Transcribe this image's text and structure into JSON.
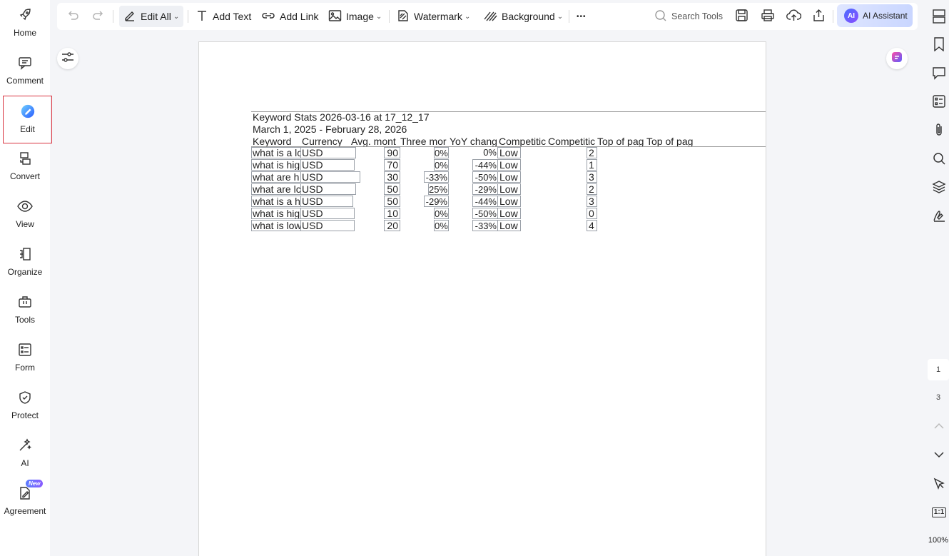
{
  "sidebar": {
    "items": [
      {
        "label": "Home",
        "icon": "rocket-icon"
      },
      {
        "label": "Comment",
        "icon": "comment-icon"
      },
      {
        "label": "Edit",
        "icon": "edit-logo-icon"
      },
      {
        "label": "Convert",
        "icon": "convert-icon"
      },
      {
        "label": "View",
        "icon": "eye-icon"
      },
      {
        "label": "Organize",
        "icon": "organize-icon"
      },
      {
        "label": "Tools",
        "icon": "toolbox-icon"
      },
      {
        "label": "Form",
        "icon": "form-icon"
      },
      {
        "label": "Protect",
        "icon": "shield-icon"
      },
      {
        "label": "AI",
        "icon": "magic-wand-icon"
      },
      {
        "label": "Agreement",
        "icon": "agreement-icon",
        "badge": "New"
      }
    ]
  },
  "toolbar": {
    "edit_all": "Edit All",
    "add_text": "Add Text",
    "add_link": "Add Link",
    "image": "Image",
    "watermark": "Watermark",
    "background": "Background",
    "more": "•••",
    "search_tools": "Search Tools",
    "ai_logo": "AI",
    "ai_assistant": "AI Assistant"
  },
  "pagination": {
    "current": "1",
    "total": "3",
    "zoom": "100%",
    "fit_label": "1:1"
  },
  "document": {
    "title": "Keyword Stats 2026-03-16 at 17_12_17",
    "date_range": "March 1, 2025 - February 28, 2026",
    "headers": [
      "Keyword",
      "Currency",
      "Avg. mont",
      "Three mor",
      "YoY chang",
      "Competitic",
      "Competitic",
      "Top of pag",
      "Top of pag"
    ],
    "rows": [
      {
        "keyword": "what is a lc",
        "currency": "USD",
        "avg": "90",
        "three": "0%",
        "yoy": "0%",
        "comp": "Low",
        "index": "2"
      },
      {
        "keyword": "what is hig",
        "currency": "USD",
        "avg": "70",
        "three": "0%",
        "yoy": "-44%",
        "comp": "Low",
        "index": "1"
      },
      {
        "keyword": "what are h",
        "currency": "USD",
        "avg": "30",
        "three": "-33%",
        "yoy": "-50%",
        "comp": "Low",
        "index": "3"
      },
      {
        "keyword": "what are lc",
        "currency": "USD",
        "avg": "50",
        "three": "25%",
        "yoy": "-29%",
        "comp": "Low",
        "index": "2"
      },
      {
        "keyword": "what is a h",
        "currency": "USD",
        "avg": "50",
        "three": "-29%",
        "yoy": "-44%",
        "comp": "Low",
        "index": "3"
      },
      {
        "keyword": "what is hig",
        "currency": "USD",
        "avg": "10",
        "three": "0%",
        "yoy": "-50%",
        "comp": "Low",
        "index": "0"
      },
      {
        "keyword": "what is low",
        "currency": "USD",
        "avg": "20",
        "three": "0%",
        "yoy": "-33%",
        "comp": "Low",
        "index": "4"
      }
    ]
  },
  "colors": {
    "active_border": "#d9333f",
    "ai_gradient_start": "#4a6cff",
    "ai_gradient_end": "#8a4cff"
  }
}
